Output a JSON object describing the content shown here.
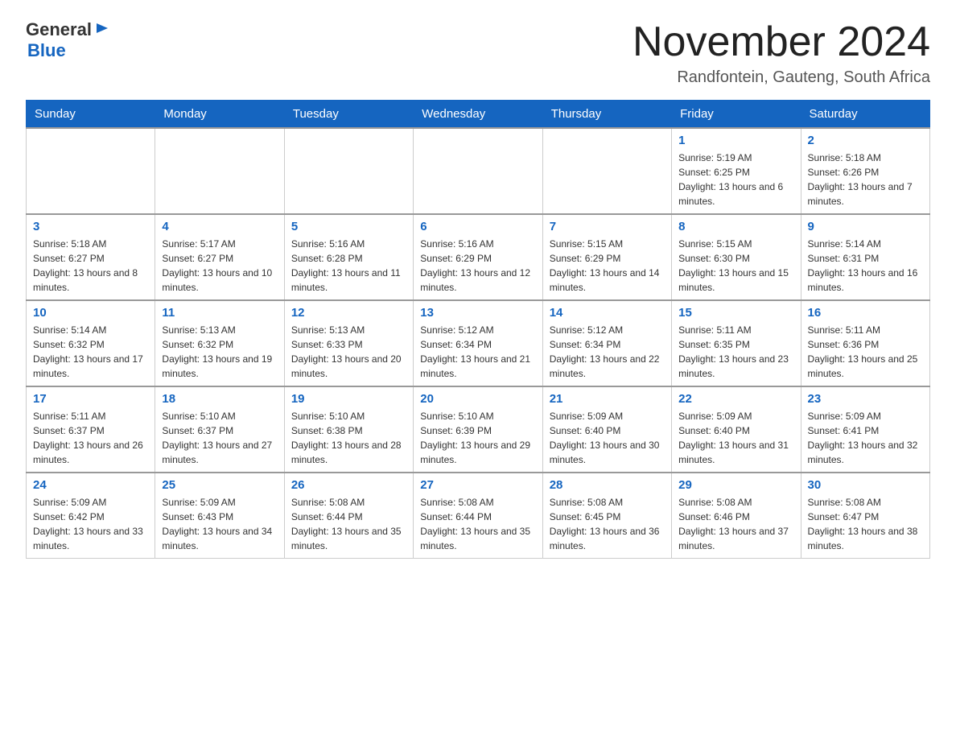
{
  "header": {
    "logo_general": "General",
    "logo_blue": "Blue",
    "title": "November 2024",
    "subtitle": "Randfontein, Gauteng, South Africa"
  },
  "days_of_week": [
    "Sunday",
    "Monday",
    "Tuesday",
    "Wednesday",
    "Thursday",
    "Friday",
    "Saturday"
  ],
  "weeks": [
    {
      "days": [
        {
          "num": "",
          "info": ""
        },
        {
          "num": "",
          "info": ""
        },
        {
          "num": "",
          "info": ""
        },
        {
          "num": "",
          "info": ""
        },
        {
          "num": "",
          "info": ""
        },
        {
          "num": "1",
          "info": "Sunrise: 5:19 AM\nSunset: 6:25 PM\nDaylight: 13 hours and 6 minutes."
        },
        {
          "num": "2",
          "info": "Sunrise: 5:18 AM\nSunset: 6:26 PM\nDaylight: 13 hours and 7 minutes."
        }
      ]
    },
    {
      "days": [
        {
          "num": "3",
          "info": "Sunrise: 5:18 AM\nSunset: 6:27 PM\nDaylight: 13 hours and 8 minutes."
        },
        {
          "num": "4",
          "info": "Sunrise: 5:17 AM\nSunset: 6:27 PM\nDaylight: 13 hours and 10 minutes."
        },
        {
          "num": "5",
          "info": "Sunrise: 5:16 AM\nSunset: 6:28 PM\nDaylight: 13 hours and 11 minutes."
        },
        {
          "num": "6",
          "info": "Sunrise: 5:16 AM\nSunset: 6:29 PM\nDaylight: 13 hours and 12 minutes."
        },
        {
          "num": "7",
          "info": "Sunrise: 5:15 AM\nSunset: 6:29 PM\nDaylight: 13 hours and 14 minutes."
        },
        {
          "num": "8",
          "info": "Sunrise: 5:15 AM\nSunset: 6:30 PM\nDaylight: 13 hours and 15 minutes."
        },
        {
          "num": "9",
          "info": "Sunrise: 5:14 AM\nSunset: 6:31 PM\nDaylight: 13 hours and 16 minutes."
        }
      ]
    },
    {
      "days": [
        {
          "num": "10",
          "info": "Sunrise: 5:14 AM\nSunset: 6:32 PM\nDaylight: 13 hours and 17 minutes."
        },
        {
          "num": "11",
          "info": "Sunrise: 5:13 AM\nSunset: 6:32 PM\nDaylight: 13 hours and 19 minutes."
        },
        {
          "num": "12",
          "info": "Sunrise: 5:13 AM\nSunset: 6:33 PM\nDaylight: 13 hours and 20 minutes."
        },
        {
          "num": "13",
          "info": "Sunrise: 5:12 AM\nSunset: 6:34 PM\nDaylight: 13 hours and 21 minutes."
        },
        {
          "num": "14",
          "info": "Sunrise: 5:12 AM\nSunset: 6:34 PM\nDaylight: 13 hours and 22 minutes."
        },
        {
          "num": "15",
          "info": "Sunrise: 5:11 AM\nSunset: 6:35 PM\nDaylight: 13 hours and 23 minutes."
        },
        {
          "num": "16",
          "info": "Sunrise: 5:11 AM\nSunset: 6:36 PM\nDaylight: 13 hours and 25 minutes."
        }
      ]
    },
    {
      "days": [
        {
          "num": "17",
          "info": "Sunrise: 5:11 AM\nSunset: 6:37 PM\nDaylight: 13 hours and 26 minutes."
        },
        {
          "num": "18",
          "info": "Sunrise: 5:10 AM\nSunset: 6:37 PM\nDaylight: 13 hours and 27 minutes."
        },
        {
          "num": "19",
          "info": "Sunrise: 5:10 AM\nSunset: 6:38 PM\nDaylight: 13 hours and 28 minutes."
        },
        {
          "num": "20",
          "info": "Sunrise: 5:10 AM\nSunset: 6:39 PM\nDaylight: 13 hours and 29 minutes."
        },
        {
          "num": "21",
          "info": "Sunrise: 5:09 AM\nSunset: 6:40 PM\nDaylight: 13 hours and 30 minutes."
        },
        {
          "num": "22",
          "info": "Sunrise: 5:09 AM\nSunset: 6:40 PM\nDaylight: 13 hours and 31 minutes."
        },
        {
          "num": "23",
          "info": "Sunrise: 5:09 AM\nSunset: 6:41 PM\nDaylight: 13 hours and 32 minutes."
        }
      ]
    },
    {
      "days": [
        {
          "num": "24",
          "info": "Sunrise: 5:09 AM\nSunset: 6:42 PM\nDaylight: 13 hours and 33 minutes."
        },
        {
          "num": "25",
          "info": "Sunrise: 5:09 AM\nSunset: 6:43 PM\nDaylight: 13 hours and 34 minutes."
        },
        {
          "num": "26",
          "info": "Sunrise: 5:08 AM\nSunset: 6:44 PM\nDaylight: 13 hours and 35 minutes."
        },
        {
          "num": "27",
          "info": "Sunrise: 5:08 AM\nSunset: 6:44 PM\nDaylight: 13 hours and 35 minutes."
        },
        {
          "num": "28",
          "info": "Sunrise: 5:08 AM\nSunset: 6:45 PM\nDaylight: 13 hours and 36 minutes."
        },
        {
          "num": "29",
          "info": "Sunrise: 5:08 AM\nSunset: 6:46 PM\nDaylight: 13 hours and 37 minutes."
        },
        {
          "num": "30",
          "info": "Sunrise: 5:08 AM\nSunset: 6:47 PM\nDaylight: 13 hours and 38 minutes."
        }
      ]
    }
  ]
}
